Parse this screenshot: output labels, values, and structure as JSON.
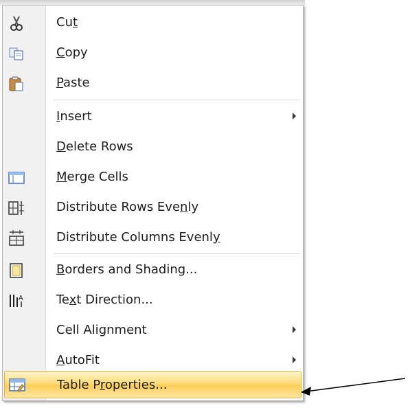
{
  "menu": {
    "items": [
      {
        "name": "cut-item",
        "icon": "scissors-icon",
        "pre": "Cu",
        "acc": "t",
        "post": "",
        "submenu": false
      },
      {
        "name": "copy-item",
        "icon": "copy-icon",
        "pre": "",
        "acc": "C",
        "post": "opy",
        "submenu": false
      },
      {
        "name": "paste-item",
        "icon": "clipboard-icon",
        "pre": "",
        "acc": "P",
        "post": "aste",
        "submenu": false
      },
      {
        "name": "insert-item",
        "icon": "",
        "pre": "",
        "acc": "I",
        "post": "nsert",
        "submenu": true
      },
      {
        "name": "delete-rows-item",
        "icon": "",
        "pre": "",
        "acc": "D",
        "post": "elete Rows",
        "submenu": false
      },
      {
        "name": "merge-cells-item",
        "icon": "merge-cells-icon",
        "pre": "",
        "acc": "M",
        "post": "erge Cells",
        "submenu": false
      },
      {
        "name": "distribute-rows-item",
        "icon": "distribute-rows-icon",
        "pre": "Distribute Rows Eve",
        "acc": "n",
        "post": "ly",
        "submenu": false
      },
      {
        "name": "distribute-columns-item",
        "icon": "distribute-columns-icon",
        "pre": "Distribute Columns Evenl",
        "acc": "y",
        "post": "",
        "submenu": false
      },
      {
        "name": "borders-shading-item",
        "icon": "borders-icon",
        "pre": "",
        "acc": "B",
        "post": "orders and Shading...",
        "submenu": false
      },
      {
        "name": "text-direction-item",
        "icon": "text-direction-icon",
        "pre": "Te",
        "acc": "x",
        "post": "t Direction...",
        "submenu": false
      },
      {
        "name": "cell-alignment-item",
        "icon": "",
        "pre": "Cell Ali",
        "acc": "g",
        "post": "nment",
        "submenu": true
      },
      {
        "name": "autofit-item",
        "icon": "",
        "pre": "",
        "acc": "A",
        "post": "utoFit",
        "submenu": true
      },
      {
        "name": "table-properties-item",
        "icon": "table-properties-icon",
        "pre": "Table P",
        "acc": "r",
        "post": "operties...",
        "submenu": false,
        "highlighted": true
      }
    ]
  },
  "colors": {
    "highlight": "#ffd973",
    "gutter": "#f1f1f1",
    "text": "#1d1d1d"
  }
}
